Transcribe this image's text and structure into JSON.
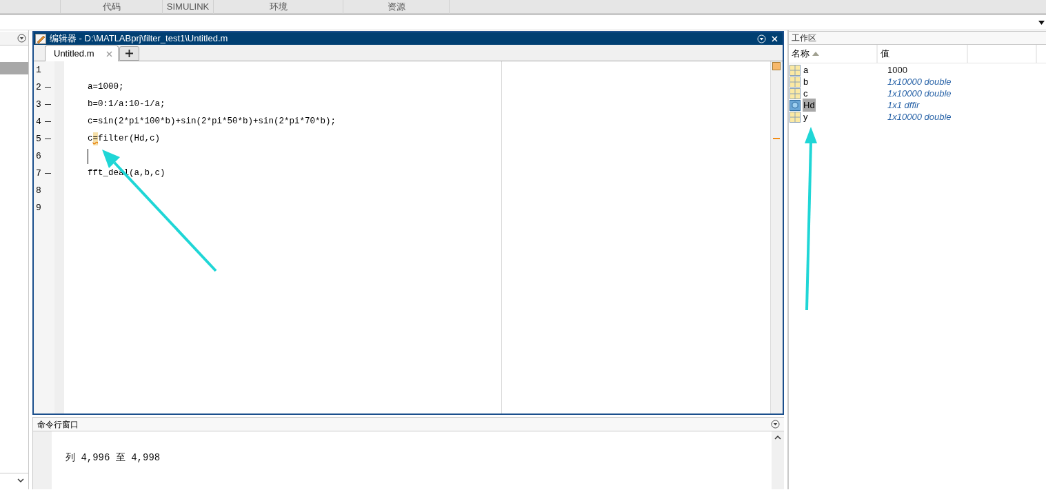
{
  "ribbon_tabs": [
    {
      "label": "代码"
    },
    {
      "label": "SIMULINK"
    },
    {
      "label": "环境"
    },
    {
      "label": "资源"
    }
  ],
  "editor": {
    "title": "编辑器 - D:\\MATLABprj\\filter_test1\\Untitled.m",
    "tabs": [
      {
        "label": "Untitled.m",
        "selected": true
      }
    ],
    "lines": [
      {
        "number": "1",
        "executable": false,
        "cursor": false
      },
      {
        "number": "2",
        "executable": true,
        "cursor": false,
        "segments": [
          {
            "text": "a=1000;",
            "warning": false
          }
        ]
      },
      {
        "number": "3",
        "executable": true,
        "cursor": false,
        "segments": [
          {
            "text": "b=0:1/a:10-1/a;",
            "warning": false
          }
        ]
      },
      {
        "number": "4",
        "executable": true,
        "cursor": false,
        "segments": [
          {
            "text": "c=sin(2*pi*100*b)+sin(2*pi*50*b)+sin(2*pi*70*b);",
            "warning": false
          }
        ]
      },
      {
        "number": "5",
        "executable": true,
        "cursor": false,
        "segments": [
          {
            "text": "c",
            "warning": false
          },
          {
            "text": "=",
            "warning": true
          },
          {
            "text": "filter(Hd,c)",
            "warning": false
          }
        ]
      },
      {
        "number": "6",
        "executable": false,
        "cursor": true
      },
      {
        "number": "7",
        "executable": true,
        "cursor": false,
        "segments": [
          {
            "text": "fft_deal(a,b,c)",
            "warning": false
          }
        ]
      },
      {
        "number": "8",
        "executable": false,
        "cursor": false
      },
      {
        "number": "9",
        "executable": false,
        "cursor": false
      }
    ]
  },
  "command_window": {
    "title": "命令行窗口",
    "lines": [
      "列 4,996 至 4,998"
    ]
  },
  "workspace": {
    "title": "工作区",
    "columns": [
      {
        "label": "名称",
        "sorted": true
      },
      {
        "label": "值",
        "sorted": false
      }
    ],
    "variables": [
      {
        "name": "a",
        "value": "1000",
        "kind": "matrix",
        "summary": false,
        "selected": false
      },
      {
        "name": "b",
        "value": "1x10000 double",
        "kind": "matrix",
        "summary": true,
        "selected": false
      },
      {
        "name": "c",
        "value": "1x10000 double",
        "kind": "matrix",
        "summary": true,
        "selected": false
      },
      {
        "name": "Hd",
        "value": "1x1 dffir",
        "kind": "object",
        "summary": true,
        "selected": true
      },
      {
        "name": "y",
        "value": "1x10000 double",
        "kind": "matrix",
        "summary": true,
        "selected": false
      }
    ]
  }
}
